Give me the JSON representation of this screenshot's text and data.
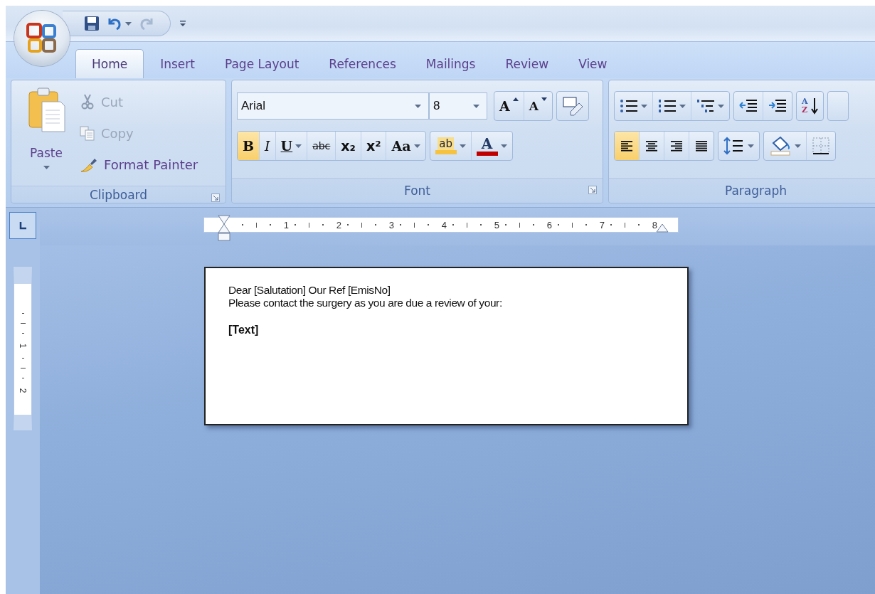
{
  "tabs": [
    {
      "label": "Home",
      "selected": true
    },
    {
      "label": "Insert",
      "selected": false
    },
    {
      "label": "Page Layout",
      "selected": false
    },
    {
      "label": "References",
      "selected": false
    },
    {
      "label": "Mailings",
      "selected": false
    },
    {
      "label": "Review",
      "selected": false
    },
    {
      "label": "View",
      "selected": false
    }
  ],
  "clipboard": {
    "paste": "Paste",
    "label": "Clipboard",
    "items": [
      {
        "kind": "cut",
        "label": "Cut",
        "disabled": true
      },
      {
        "kind": "copy",
        "label": "Copy",
        "disabled": true
      },
      {
        "kind": "painter",
        "label": "Format Painter",
        "disabled": false
      }
    ]
  },
  "font": {
    "name": "Arial",
    "size": "8",
    "label": "Font",
    "size_buttons": [
      {
        "kind": "grow",
        "glyph": "A"
      },
      {
        "kind": "shrink",
        "glyph": "A"
      }
    ],
    "format_buttons": [
      {
        "kind": "bold",
        "glyph": "B",
        "selected": true
      },
      {
        "kind": "italic",
        "glyph": "I",
        "selected": false
      },
      {
        "kind": "underline",
        "glyph": "U",
        "selected": false
      },
      {
        "kind": "strike",
        "glyph": "abc",
        "selected": false
      },
      {
        "kind": "subscript",
        "glyph": "x₂",
        "selected": false
      },
      {
        "kind": "superscript",
        "glyph": "x²",
        "selected": false
      },
      {
        "kind": "case",
        "glyph": "Aa",
        "selected": false
      }
    ],
    "color_buttons": [
      {
        "kind": "highlight",
        "glyph": "ab",
        "color": "#f5c242"
      },
      {
        "kind": "font_color",
        "glyph": "A",
        "color": "#c00000"
      }
    ]
  },
  "paragraph": {
    "label": "Paragraph",
    "sort_glyphs": [
      "A",
      "Z"
    ],
    "align_buttons": [
      {
        "kind": "left",
        "selected": true
      },
      {
        "kind": "center",
        "selected": false
      },
      {
        "kind": "right",
        "selected": false
      },
      {
        "kind": "justify",
        "selected": false
      }
    ]
  },
  "ruler": {
    "marks": [
      "1",
      "2",
      "3",
      "4",
      "5",
      "6",
      "7",
      "8"
    ]
  },
  "vertical_ruler": {
    "marks": [
      "1",
      "2"
    ]
  },
  "document": {
    "lines": [
      "Dear [Salutation] Our Ref [EmisNo]",
      "Please contact the surgery as you are due a review of your:"
    ],
    "field": "[Text]"
  }
}
